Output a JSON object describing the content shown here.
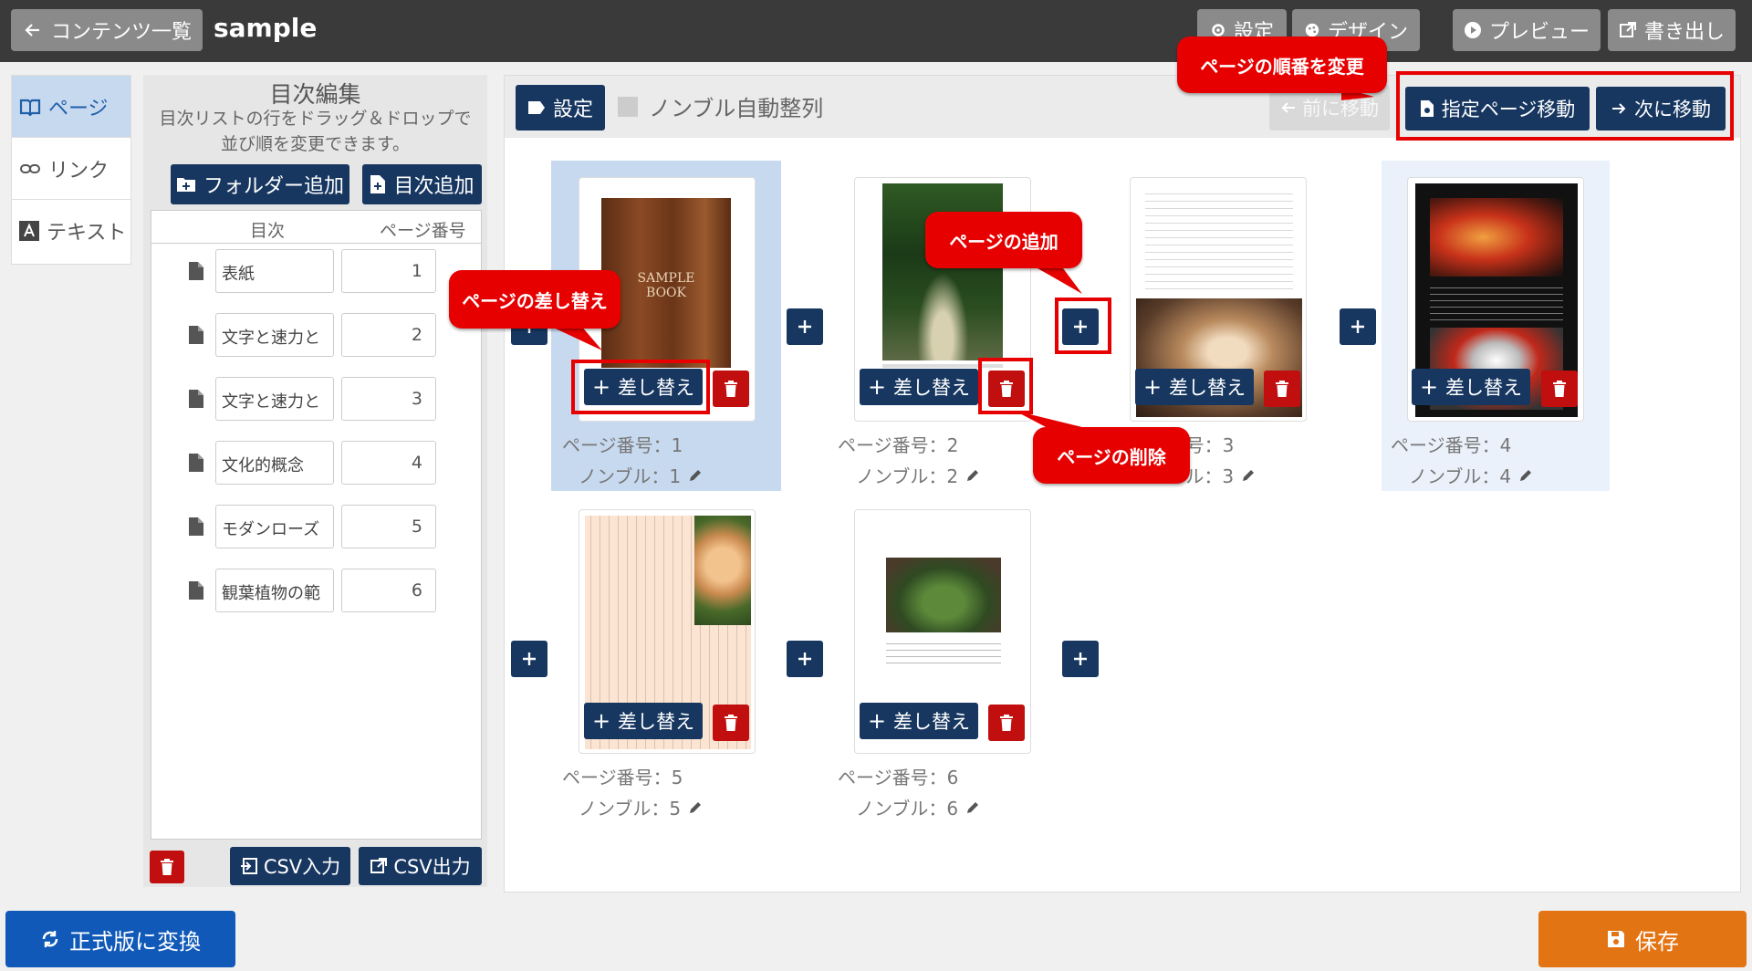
{
  "topbar": {
    "back_label": "コンテンツ一覧",
    "title": "sample",
    "settings_label": "設定",
    "design_label": "デザイン",
    "preview_label": "プレビュー",
    "export_label": "書き出し"
  },
  "leftnav": {
    "items": [
      {
        "label": "ページ",
        "icon": "book-open-icon"
      },
      {
        "label": "リンク",
        "icon": "link-icon"
      },
      {
        "label": "テキスト",
        "icon": "text-a-icon"
      }
    ]
  },
  "toc": {
    "title": "目次編集",
    "description_line1": "目次リストの行をドラッグ＆ドロップで",
    "description_line2": "並び順を変更できます。",
    "add_folder_label": "フォルダー追加",
    "add_toc_label": "目次追加",
    "col_toc": "目次",
    "col_page": "ページ番号",
    "rows": [
      {
        "name": "表紙",
        "page": "1"
      },
      {
        "name": "文字と速力と",
        "page": "2"
      },
      {
        "name": "文字と速力と",
        "page": "3"
      },
      {
        "name": "文化的概念",
        "page": "4"
      },
      {
        "name": "モダンローズ",
        "page": "5"
      },
      {
        "name": "観葉植物の範",
        "page": "6"
      }
    ],
    "csv_in_label": "CSV入力",
    "csv_out_label": "CSV出力"
  },
  "main": {
    "settings_label": "設定",
    "nombre_auto_label": "ノンブル自動整列",
    "prev_label": "前に移動",
    "goto_page_label": "指定ページ移動",
    "next_label": "次に移動",
    "replace_label": "差し替え",
    "cover_text_line1": "SAMPLE",
    "cover_text_line2": "BOOK",
    "pages": [
      {
        "page_no": "ページ番号：1",
        "nombre": "ノンブル：1"
      },
      {
        "page_no": "ページ番号：2",
        "nombre": "ノンブル：2"
      },
      {
        "page_no": "ページ番号：3",
        "nombre": "ノンブル：3"
      },
      {
        "page_no": "ページ番号：4",
        "nombre": "ノンブル：4"
      },
      {
        "page_no": "ページ番号：5",
        "nombre": "ノンブル：5"
      },
      {
        "page_no": "ページ番号：6",
        "nombre": "ノンブル：6"
      }
    ]
  },
  "callouts": {
    "reorder": "ページの順番を変更",
    "replace": "ページの差し替え",
    "add": "ページの追加",
    "delete": "ページの削除"
  },
  "footer": {
    "convert_label": "正式版に変換",
    "save_label": "保存"
  },
  "colors": {
    "navy": "#173761",
    "red": "#c10e0e",
    "callout_red": "#e60000",
    "blue": "#1059b8",
    "orange": "#e37413",
    "selected": "#c7d9ef"
  }
}
